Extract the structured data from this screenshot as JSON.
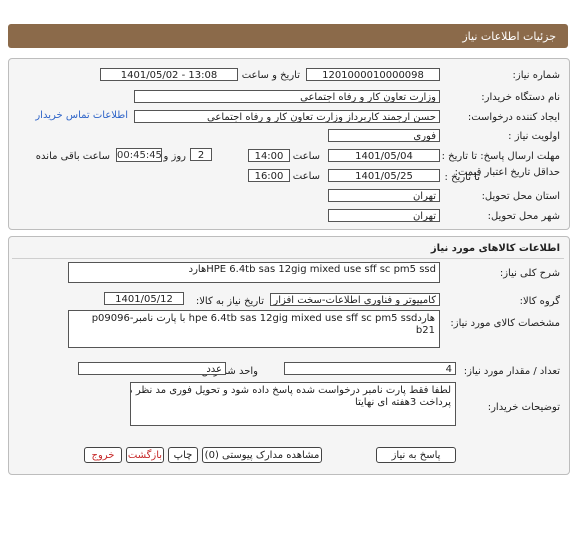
{
  "header": {
    "title": "جزئیات اطلاعات نیاز"
  },
  "info": {
    "need_number_label": "شماره نیاز:",
    "need_number": "1201000010000098",
    "announce_label": "تاریخ و ساعت اعلان عمومی:",
    "announce_value": "1401/05/02 - 13:08",
    "buyer_label": "نام دستگاه خریدار:",
    "buyer_value": "وزارت تعاون کار و رفاه اجتماعی",
    "creator_label": "ایجاد کننده درخواست:",
    "creator_value": "حسن ارجمند کاربرداز وزارت تعاون کار و رفاه اجتماعی",
    "contact_link": "اطلاعات تماس خریدار",
    "priority_label": "اولویت نیاز :",
    "priority_value": "فوری",
    "deadline_label": "مهلت ارسال پاسخ: تا تاریخ :",
    "deadline_date": "1401/05/04",
    "time_label": "ساعت",
    "deadline_time": "14:00",
    "days_value": "2",
    "days_label": "روز و",
    "timer_value": "00:45:45",
    "remaining_label": "ساعت باقی مانده",
    "validity_label": "حداقل تاریخ اعتبار قیمت:",
    "validity_to_label": "تا تاریخ :",
    "validity_date": "1401/05/25",
    "validity_time_label": "ساعت",
    "validity_time": "16:00",
    "province_label": "استان محل تحویل:",
    "province_value": "تهران",
    "city_label": "شهر محل تحویل:",
    "city_value": "تهران"
  },
  "goods": {
    "title": "اطلاعات کالاهای مورد نیاز",
    "desc_label": "شرح کلی نیاز:",
    "desc_value": "هاردHPE 6.4tb sas 12gig mixed use sff sc pm5 ssd",
    "group_label": "گروه کالا:",
    "group_value": "کامپیوتر و فناوری اطلاعات-سخت افزار",
    "need_date_label": "تاریخ نیاز به کالا:",
    "need_date_value": "1401/05/12",
    "spec_label": "مشخصات کالای مورد نیاز:",
    "spec_value": "هاردhpe 6.4tb sas 12gig mixed use sff sc pm5 ssd     با پارت نامبرp09096-b21",
    "qty_label": "تعداد / مقدار مورد نیاز:",
    "qty_value": "4",
    "unit_label": "واحد شمارش:",
    "unit_value": "عدد",
    "buyer_notes_label": "توضیحات خریدار:",
    "buyer_notes_line1": "لطفا فقط پارت نامبر درخواست شده پاسخ داده شود و  تحویل فوری مد نظر می باشد",
    "buyer_notes_line2": "پرداخت 3هفته ای نهایتا"
  },
  "actions": {
    "reply": "پاسخ به نیاز",
    "attachments": "مشاهده مدارک پیوستی (0)",
    "print": "چاپ",
    "back": "بازگشت",
    "exit": "خروج"
  }
}
